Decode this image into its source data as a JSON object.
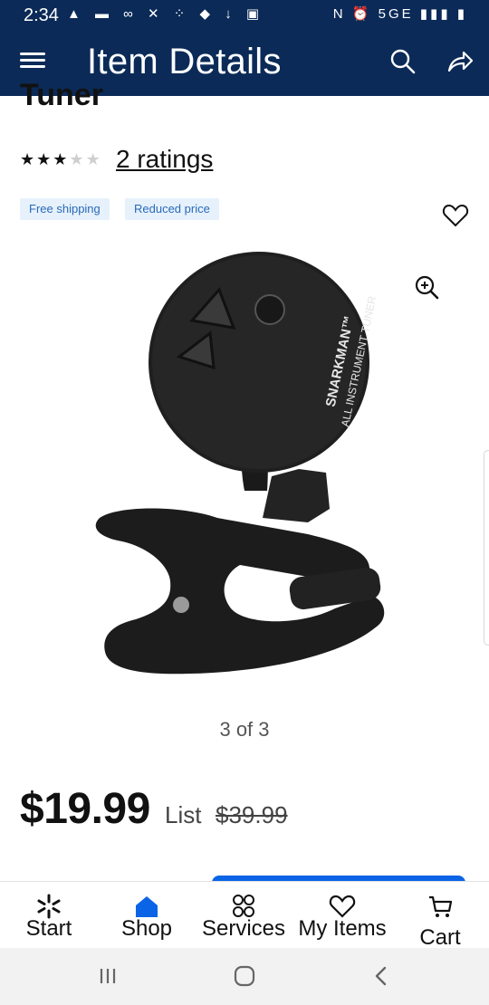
{
  "status_bar": {
    "time": "2:34",
    "left_icons": "▲ ▬ ∞ ✕ ⁘ ◆ ↓ ▣",
    "right_icons": "N ⏰ 5GE ▮▮▮ ▮",
    "network": "5GE"
  },
  "header": {
    "title": "Item Details",
    "menu_icon": "hamburger-icon",
    "search_icon": "search-icon",
    "share_icon": "share-icon"
  },
  "product": {
    "title_partial": "Tuner",
    "rating_stars_filled": 3,
    "rating_stars_total": 5,
    "ratings_text": "2 ratings",
    "badges": [
      "Free shipping",
      "Reduced price"
    ],
    "image_pager": "3 of 3",
    "device_label_line1": "SNARKMAN™",
    "device_label_line2": "ALL INSTRUMENT TUNER",
    "price": "$19.99",
    "list_label": "List",
    "list_price": "$39.99"
  },
  "bottom_nav": {
    "items": [
      {
        "label": "Start",
        "icon": "spark-icon"
      },
      {
        "label": "Shop",
        "icon": "home-icon"
      },
      {
        "label": "Services",
        "icon": "services-icon"
      },
      {
        "label": "My Items",
        "icon": "heart-icon"
      },
      {
        "label": "Cart",
        "icon": "cart-icon"
      }
    ]
  },
  "system_nav": {
    "recents_icon": "recents-icon",
    "home_icon": "home-circle-icon",
    "back_icon": "back-icon"
  },
  "colors": {
    "header_bg": "#0b2a57",
    "accent_blue": "#0b64e6",
    "badge_bg": "#e6f1fc",
    "badge_text": "#2a6ab7"
  }
}
